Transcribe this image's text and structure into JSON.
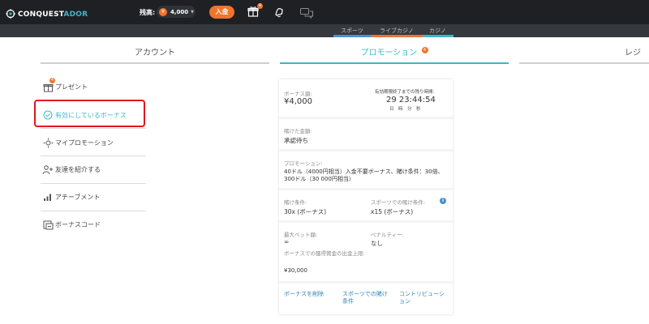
{
  "topbar": {
    "logo_prefix": "CONQUEST",
    "logo_suffix": "ADOR",
    "balance_label": "残高:",
    "balance_coin": "¥",
    "balance_value": "4,000",
    "deposit_label": "入金",
    "gift_badge": "4"
  },
  "subnav": {
    "tabs": [
      {
        "label": "スポーツ",
        "color": "#4a90d9"
      },
      {
        "label": "ライブカジノ",
        "color": "#e8743b"
      },
      {
        "label": "カジノ",
        "color": "#3fb6c6"
      }
    ]
  },
  "sections": {
    "account": "アカウント",
    "promotion": "プロモーション",
    "promotion_badge": "4",
    "register": "レジ"
  },
  "menu": {
    "items": [
      {
        "label": "プレゼント",
        "badge": "4",
        "icon": "gift-icon"
      },
      {
        "label": "有効にしているボーナス",
        "icon": "clock-check-icon",
        "active": true
      },
      {
        "label": "マイプロモーション",
        "icon": "megaphone-icon"
      },
      {
        "label": "友達を紹介する",
        "icon": "users-add-icon"
      },
      {
        "label": "アチーブメント",
        "icon": "bar-chart-icon"
      },
      {
        "label": "ボーナスコード",
        "icon": "code-icon"
      }
    ]
  },
  "bonus_card": {
    "bonus_amount_label": "ボーナス額:",
    "bonus_amount": "¥4,000",
    "remaining_label": "有効期限終了までの残り時間:",
    "remaining_time": "29 23:44:54",
    "time_units": "日　時　分　秒",
    "wagered_label": "賭けた金額:",
    "wagered_value": "承認待ち",
    "promotion_label": "プロモーション:",
    "promotion_value": "40ドル（4000円相当）入金不要ボーナス、賭け条件：30倍、300ドル（30 000円相当）",
    "wager_req_label": "賭け条件:",
    "wager_req_value": "30x (ボーナス)",
    "sports_wager_label": "スポーツでの賭け条件:",
    "sports_wager_value": "x15 (ボーナス)",
    "max_bet_label": "最大ベット額:",
    "max_bet_value": "∞",
    "penalty_label": "ペナルティー:",
    "penalty_value": "なし",
    "max_withdraw_label": "ボーナスでの獲得賞金の出金上限:",
    "max_withdraw_value": "¥30,000",
    "links": {
      "delete": "ボーナスを削除",
      "sports": "スポーツでの賭け条件",
      "contribution": "コントリビューション"
    }
  },
  "colors": {
    "accent": "#3fb6c6",
    "orange": "#f1742b",
    "highlight": "#e3141e"
  }
}
